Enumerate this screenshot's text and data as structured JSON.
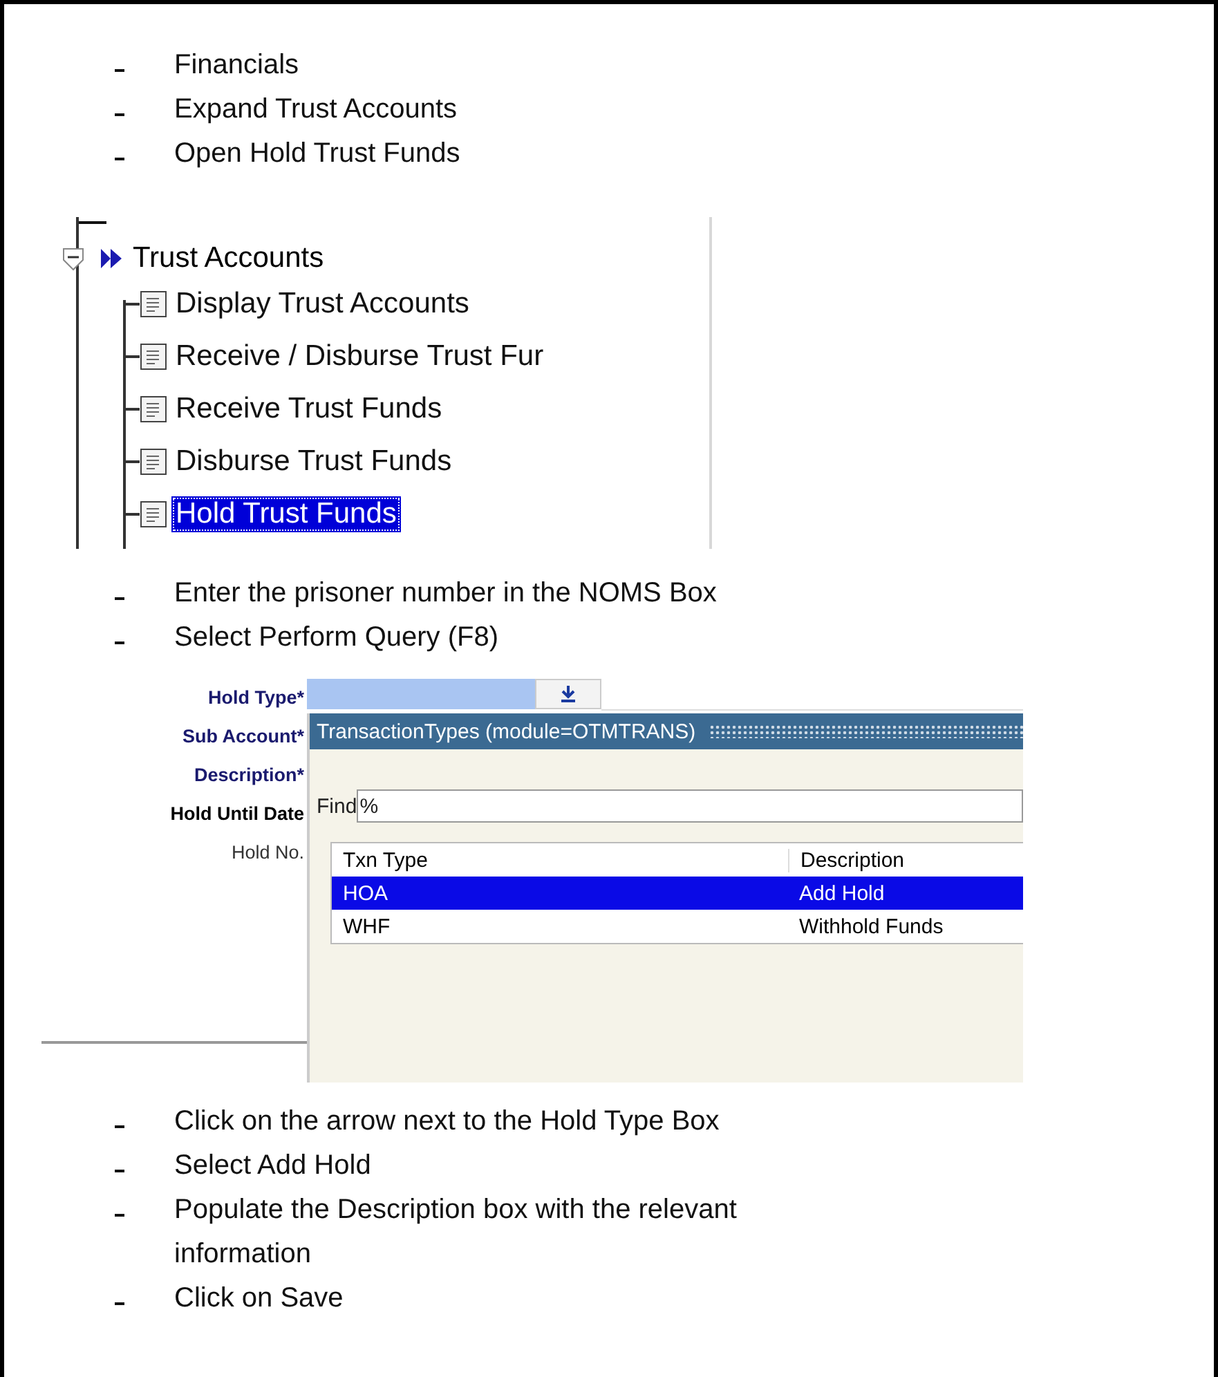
{
  "intro_steps": [
    "Financials",
    "Expand Trust Accounts",
    "Open Hold Trust Funds"
  ],
  "tree": {
    "items": [
      {
        "label": "Trust Accounts",
        "expanded": true,
        "children": [
          {
            "label": "Display Trust Accounts",
            "selected": false
          },
          {
            "label": "Receive / Disburse Trust Fur",
            "selected": false
          },
          {
            "label": "Receive Trust Funds",
            "selected": false
          },
          {
            "label": "Disburse Trust Funds",
            "selected": false
          },
          {
            "label": "Hold Trust Funds",
            "selected": true
          }
        ]
      }
    ]
  },
  "query_steps": [
    "Enter the prisoner number in the NOMS Box",
    "Select Perform Query (F8)"
  ],
  "form": {
    "fields": [
      {
        "label": "Hold Type*",
        "kind": "mandatory"
      },
      {
        "label": "Sub Account*",
        "kind": "mandatory"
      },
      {
        "label": "Description*",
        "kind": "mandatory"
      },
      {
        "label": "Hold Until Date",
        "kind": "bold"
      },
      {
        "label": "Hold No.",
        "kind": "plain"
      }
    ],
    "popup": {
      "title": "TransactionTypes (module=OTMTRANS)",
      "find_label": "Find",
      "find_value": "%",
      "columns": [
        "Txn Type",
        "Description"
      ],
      "rows": [
        {
          "cells": [
            "HOA",
            "Add Hold"
          ],
          "selected": true
        },
        {
          "cells": [
            "WHF",
            "Withhold Funds"
          ],
          "selected": false
        }
      ]
    }
  },
  "final_steps": [
    "Click on the arrow next to the Hold Type Box",
    "Select Add Hold",
    "Populate the Description box with the relevant information",
    "Click on Save"
  ]
}
